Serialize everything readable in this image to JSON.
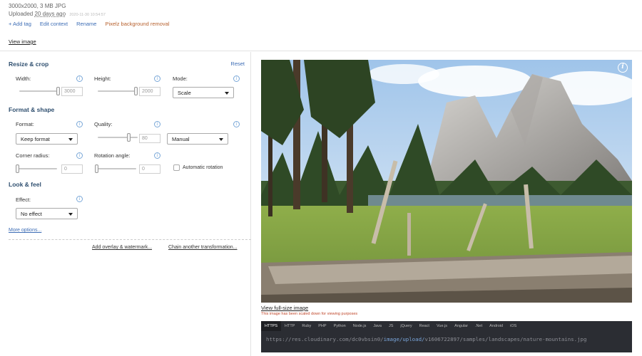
{
  "header": {
    "dimensions": "3000x2000, 3 MB JPG",
    "uploaded_prefix": "Uploaded",
    "uploaded_ago": "20 days ago",
    "uploaded_ts": "2020-11-30 10:54:57",
    "actions": {
      "add_tag": "+ Add tag",
      "edit_context": "Edit context",
      "rename": "Rename",
      "pixelz": "Pixelz background removal"
    },
    "view_image": "View image"
  },
  "resize": {
    "title": "Resize & crop",
    "reset": "Reset",
    "width_label": "Width:",
    "width_value": "3000",
    "width_fraction": 1.0,
    "height_label": "Height:",
    "height_value": "2000",
    "height_fraction": 1.0,
    "mode_label": "Mode:",
    "mode_value": "Scale"
  },
  "format": {
    "title": "Format & shape",
    "format_label": "Format:",
    "format_value": "Keep format",
    "quality_label": "Quality:",
    "quality_value": "80",
    "quality_fraction": 0.8,
    "quality_mode": "Manual",
    "corner_label": "Corner radius:",
    "corner_value": "0",
    "corner_fraction": 0,
    "rotation_label": "Rotation angle:",
    "rotation_value": "0",
    "rotation_fraction": 0,
    "auto_rotation": "Automatic rotation"
  },
  "look": {
    "title": "Look & feel",
    "effect_label": "Effect:",
    "effect_value": "No effect"
  },
  "links": {
    "more_options": "More options...",
    "add_overlay": "Add overlay & watermark...",
    "chain": "Chain another transformation..."
  },
  "preview": {
    "full_size": "View full-size image",
    "scaled_note": "This image has been scaled down for viewing purposes"
  },
  "code": {
    "tabs": [
      "HTTPS",
      "HTTP",
      "Ruby",
      "PHP",
      "Python",
      "Node.js",
      "Java",
      "JS",
      "jQuery",
      "React",
      "Vue.js",
      "Angular",
      ".Net",
      "Android",
      "iOS"
    ],
    "active_tab": "HTTPS",
    "url_prefix": "https://res.cloudinary.com/dc0vbsin0/",
    "url_highlight": "image/upload/",
    "url_suffix": "v1606722897/samples/landscapes/nature-mountains.jpg"
  },
  "icons": {
    "info": "info-icon",
    "dropdown": "caret-down-icon"
  }
}
